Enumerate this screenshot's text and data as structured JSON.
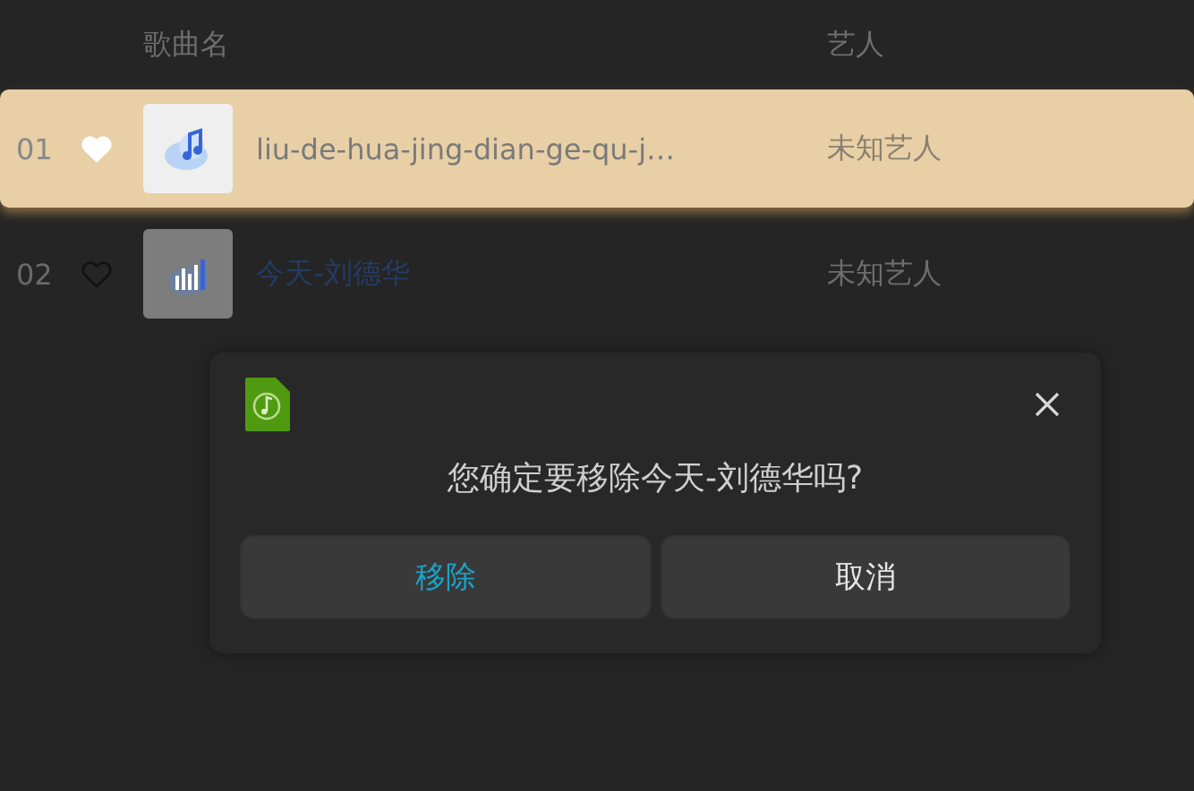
{
  "columns": [
    "歌曲名",
    "艺人"
  ],
  "rows": [
    {
      "number": "01",
      "favorite": true,
      "cover": {
        "kind": "cloud"
      },
      "title": "liu-de-hua-jing-dian-ge-qu-j…",
      "artist": "未知艺人",
      "selected": true,
      "playing": false
    },
    {
      "number": "02",
      "favorite": false,
      "cover": {
        "kind": "bars"
      },
      "title": "今天-刘德华",
      "artist": "未知艺人",
      "selected": false,
      "playing": true
    }
  ],
  "dialog": {
    "message": "您确定要移除今天-刘德华吗?",
    "buttons": [
      {
        "label": "移除",
        "kind": "confirm"
      },
      {
        "label": "取消",
        "kind": "cancel"
      }
    ]
  }
}
